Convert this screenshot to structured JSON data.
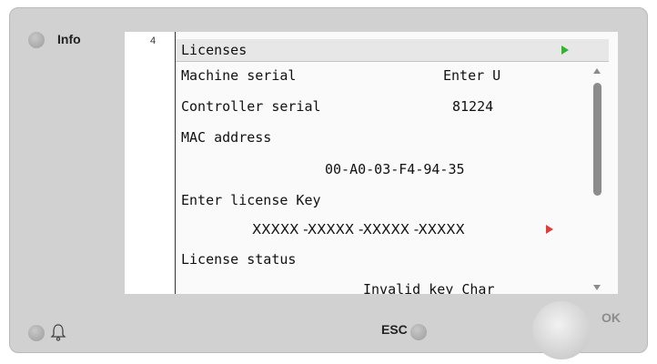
{
  "controls": {
    "info_label": "Info",
    "esc_label": "ESC",
    "ok_label": "OK"
  },
  "screen": {
    "page_number": "4",
    "title": "Licenses",
    "rows": {
      "machine_serial_label": "Machine serial",
      "machine_serial_value": "Enter U",
      "controller_serial_label": "Controller serial",
      "controller_serial_value": "81224",
      "mac_label": "MAC address",
      "mac_value": "00-A0-03-F4-94-35",
      "license_key_label": "Enter license Key",
      "license_key_value": "XXXXX -XXXXX -XXXXX -XXXXX",
      "license_status_label": "License status",
      "license_status_value": "Invalid key Char"
    }
  },
  "colors": {
    "panel": "#d1d1d1",
    "screen": "#fafafa",
    "header": "#e7e7e7",
    "nav_arrow_green": "#2fb52f",
    "edit_arrow_red": "#e33a3a"
  },
  "icons": {
    "bell": "bell-icon",
    "info_led": "led-indicator",
    "scroll": "scrollbar"
  }
}
